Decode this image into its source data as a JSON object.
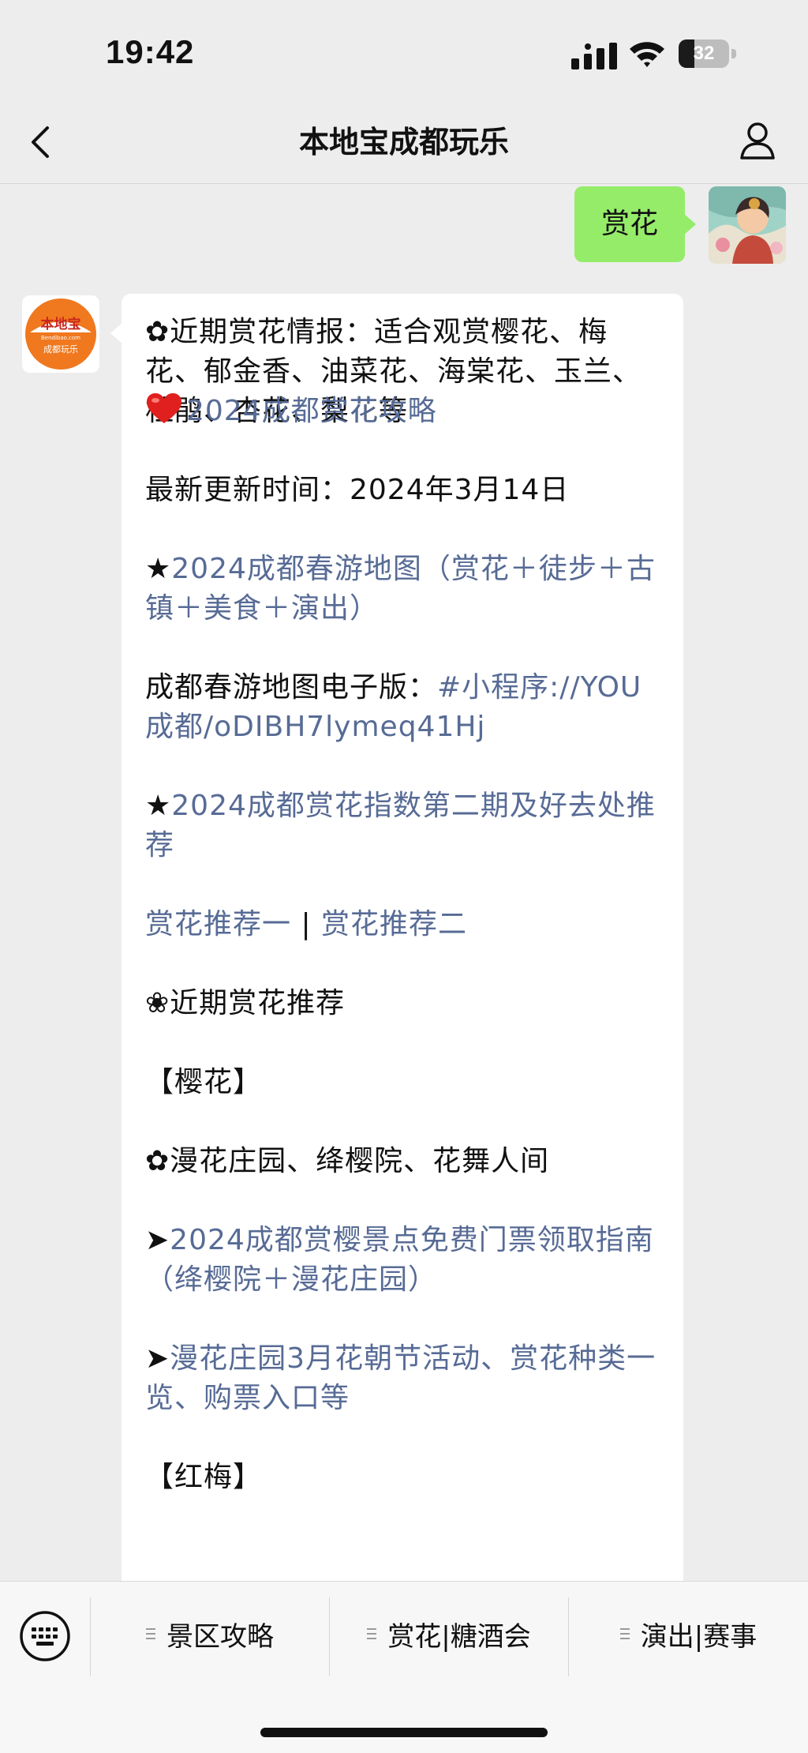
{
  "status": {
    "time": "19:42",
    "battery": "32",
    "battery_level": 0.32
  },
  "header": {
    "title": "本地宝成都玩乐"
  },
  "sent": {
    "text": "赏花"
  },
  "bot_avatar": {
    "brand": "本地宝",
    "domain": "Bendibao.com",
    "sub": "成都玩乐"
  },
  "reply": {
    "intro": "✿近期赏花情报：适合观赏樱花、梅花、郁金香、油菜花、海棠花、玉兰、杜鹃、杏花、梨花等",
    "guide_link": "2024成都赏花攻略",
    "updated": "最新更新时间：2024年3月14日",
    "map_prefix": "★",
    "map_link": "2024成都春游地图（赏花＋徒步＋古镇＋美食＋演出）",
    "e_map_label": "成都春游地图电子版：",
    "e_map_link": "#小程序://YOU成都/oDIBH7lymeq41Hj",
    "index_prefix": "★",
    "index_link": "2024成都赏花指数第二期及好去处推荐",
    "rec1": "赏花推荐一",
    "sep": " | ",
    "rec2": "赏花推荐二",
    "recent": "❀近期赏花推荐",
    "cherry_header": "【樱花】",
    "cherry_places": "✿漫花庄园、绛樱院、花舞人间",
    "arrow": "➤",
    "ticket_link": "2024成都赏樱景点免费门票领取指南（绛樱院＋漫花庄园）",
    "festival_link": "漫花庄园3月花朝节活动、赏花种类一览、购票入口等",
    "plum_header": "【红梅】"
  },
  "bottom_menu": {
    "items": [
      "景区攻略",
      "赏花|糖酒会",
      "演出|赛事"
    ]
  },
  "colors": {
    "link": "#576b95",
    "my_bubble": "#95ec69",
    "brand_orange": "#f0781e"
  },
  "icons": [
    "back-arrow-icon",
    "profile-icon",
    "keyboard-icon",
    "heart-icon",
    "wifi-icon",
    "signal-icon",
    "battery-icon"
  ]
}
